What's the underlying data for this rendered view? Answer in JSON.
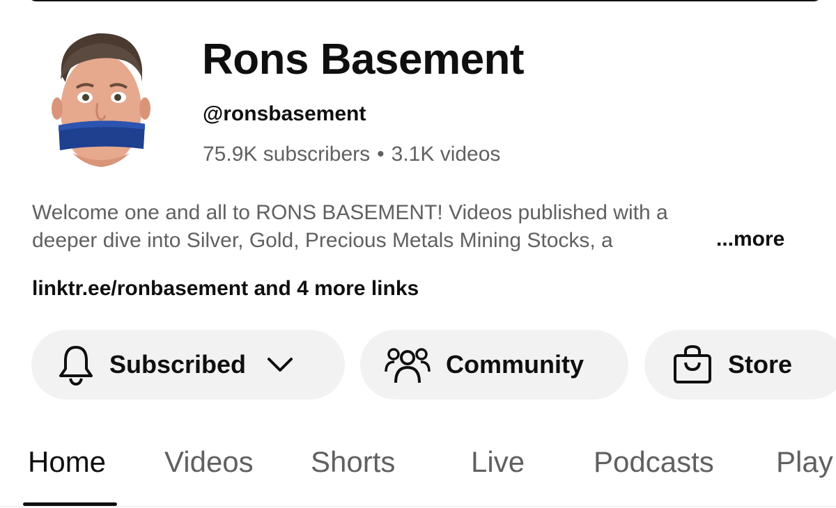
{
  "channel": {
    "name": "Rons Basement",
    "handle": "@ronsbasement",
    "subscribers": "75.9K subscribers",
    "separator": "•",
    "videos": "3.1K videos"
  },
  "description": {
    "line1": "Welcome one and all to RONS BASEMENT!  Videos published with a",
    "line2": "deeper dive into Silver, Gold, Precious Metals Mining Stocks, a",
    "more_label": "...more"
  },
  "links": {
    "text": "linktr.ee/ronbasement and 4 more links"
  },
  "actions": {
    "subscribed_label": "Subscribed",
    "community_label": "Community",
    "store_label": "Store"
  },
  "tabs": [
    {
      "label": "Home"
    },
    {
      "label": "Videos"
    },
    {
      "label": "Shorts"
    },
    {
      "label": "Live"
    },
    {
      "label": "Podcasts"
    },
    {
      "label": "Play"
    }
  ],
  "colors": {
    "text_primary": "#0f0f0f",
    "text_secondary": "#606060",
    "button_bg": "#f2f2f2",
    "avatar_tape": "#1f3f8f"
  },
  "icons": {
    "subscribed": "bell-icon",
    "subscribed_menu": "chevron-down-icon",
    "community": "people-icon",
    "store": "shopping-bag-icon"
  }
}
